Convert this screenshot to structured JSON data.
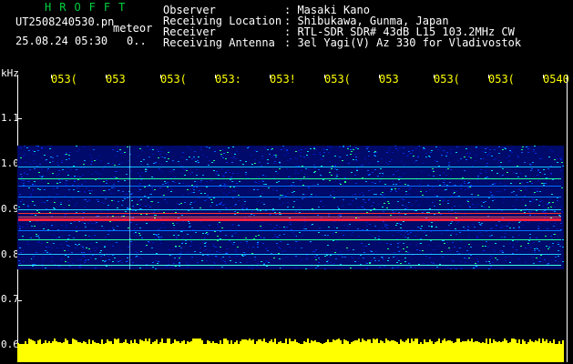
{
  "brand": "HROFFT",
  "file_name": "UT2508240530.pn",
  "meteor_label": "meteor",
  "timestamp": "25.08.24 05:30",
  "count_label": "0..",
  "info": [
    {
      "key": "Observer",
      "value": ": Masaki Kano"
    },
    {
      "key": "Receiving Location",
      "value": ": Shibukawa, Gunma, Japan"
    },
    {
      "key": "Receiver",
      "value": ": RTL-SDR SDR# 43dB L15 103.2MHz CW"
    },
    {
      "key": "Receiving Antenna",
      "value": ": 3el Yagi(V) Az 330 for Vladivostok"
    }
  ],
  "y_unit": "kHz",
  "y_ticks": [
    "1.1",
    "1.0",
    "0.9",
    "0.8",
    "0.7",
    "0.6"
  ],
  "x_ticks": [
    "053(",
    "053",
    "053(",
    "053:",
    "053!",
    "053(",
    "053",
    "053(",
    "053(",
    "0540"
  ],
  "colors": {
    "background": "#000000",
    "brand": "#00d040",
    "axis_labels": "#ffff00",
    "text": "#ffffff"
  }
}
